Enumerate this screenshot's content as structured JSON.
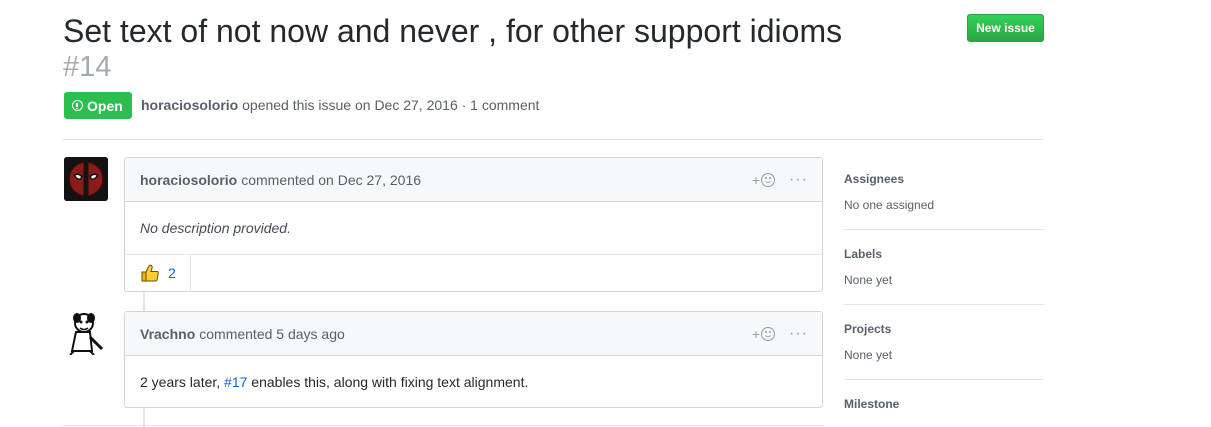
{
  "issue": {
    "title": "Set text of not now and never , for other support idioms",
    "number": "#14",
    "state": "Open",
    "author": "horaciosolorio",
    "opened_text": "opened this issue on Dec 27, 2016 · 1 comment",
    "new_issue_label": "New issue"
  },
  "comments": [
    {
      "author": "horaciosolorio",
      "time_text": "commented on Dec 27, 2016",
      "body": "No description provided.",
      "reaction_count": "2",
      "add_reaction": "+",
      "more": "···"
    },
    {
      "author": "Vrachno",
      "time_text": "commented 5 days ago",
      "body_before": "2 years later, ",
      "body_link": "#17",
      "body_after": " enables this, along with fixing text alignment.",
      "add_reaction": "+",
      "more": "···"
    }
  ],
  "sidebar": {
    "assignees": {
      "heading": "Assignees",
      "value": "No one assigned"
    },
    "labels": {
      "heading": "Labels",
      "value": "None yet"
    },
    "projects": {
      "heading": "Projects",
      "value": "None yet"
    },
    "milestone": {
      "heading": "Milestone"
    }
  },
  "colors": {
    "open_green": "#2cbe4e",
    "link_blue": "#0366d6",
    "muted_gray": "#586069"
  }
}
